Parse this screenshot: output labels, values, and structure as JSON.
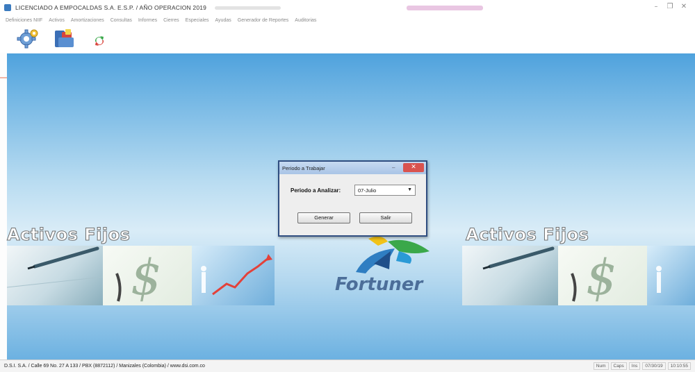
{
  "window": {
    "title": "LICENCIADO A  EMPOCALDAS S.A. E.S.P.  /  AÑO OPERACION 2019",
    "controls": [
      "–",
      "❐",
      "✕"
    ]
  },
  "menu": {
    "items": [
      "Definiciones NIIF",
      "Activos",
      "Amortizaciones",
      "Consultas",
      "Informes",
      "Cierres",
      "Especiales",
      "Ayudas",
      "Generador de Reportes",
      "Auditorias"
    ]
  },
  "toolbar": {
    "icons": [
      "gear-icon",
      "binder-icon",
      "recycle-icon"
    ]
  },
  "background": {
    "brand_left": "Activos Fijos",
    "brand_right": "Activos Fijos",
    "logo_text": "Fortuner",
    "colors": {
      "sky_top": "#4fa2dd",
      "sky_mid": "#d9ecf7",
      "logo_blue": "#4c6e99",
      "logo_green": "#3aa84a",
      "logo_yellow": "#f2c318"
    }
  },
  "dialog": {
    "title": "Periodo a Trabajar",
    "close_glyph": "✕",
    "minimize_glyph": "–",
    "field_label": "Periodo a Analizar:",
    "selected_period": "07-Julio",
    "generate_label": "Generar",
    "exit_label": "Salir"
  },
  "statusbar": {
    "text": "D.S.I. S.A. / Calle 69 No. 27 A 133 / PBX (8872112) / Manizales (Colombia) / www.dsi.com.co",
    "indicators": [
      "Num",
      "Caps",
      "Ins",
      "07/30/19",
      "10:10:55"
    ]
  }
}
